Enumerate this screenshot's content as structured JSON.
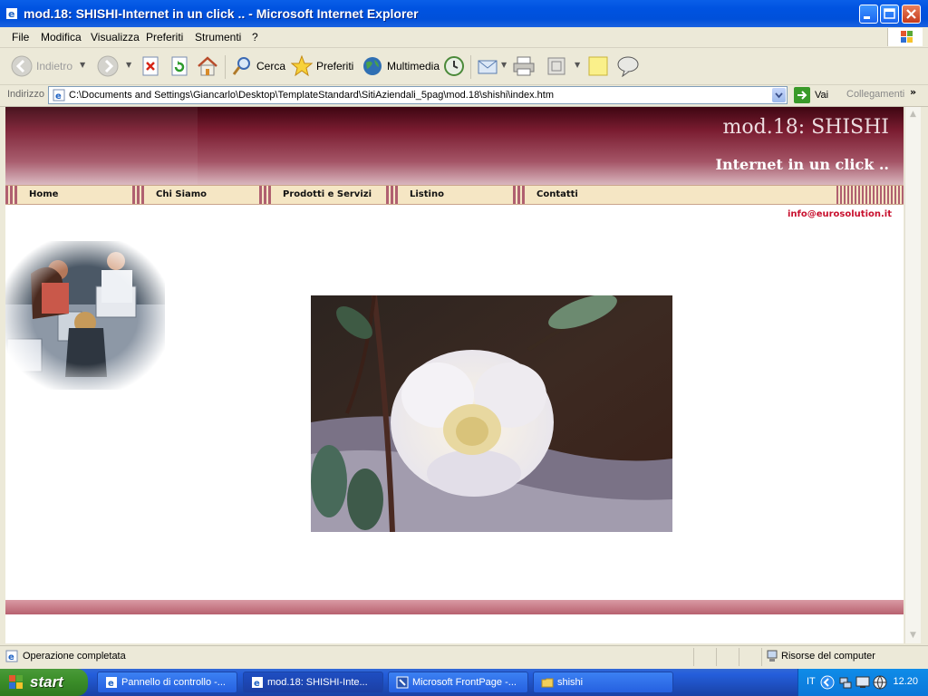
{
  "window": {
    "title": "mod.18: SHISHI-Internet in un click .. - Microsoft Internet Explorer"
  },
  "menu": [
    "File",
    "Modifica",
    "Visualizza",
    "Preferiti",
    "Strumenti",
    "?"
  ],
  "toolbar": {
    "back": "Indietro",
    "search": "Cerca",
    "favorites": "Preferiti",
    "media": "Multimedia"
  },
  "address": {
    "label": "Indirizzo",
    "url": "C:\\Documents and Settings\\Giancarlo\\Desktop\\TemplateStandard\\SitiAziendali_5pag\\mod.18\\shishi\\index.htm",
    "go": "Vai",
    "links": "Collegamenti"
  },
  "page": {
    "title": "mod.18: SHISHI",
    "subtitle": "Internet in un click ..",
    "nav": [
      "Home",
      "Chi Siamo",
      "Prodotti e Servizi",
      "Listino",
      "Contatti"
    ],
    "email": "info@eurosolution.it"
  },
  "status": {
    "text": "Operazione completata",
    "zone": "Risorse del computer"
  },
  "taskbar": {
    "start": "start",
    "tasks": [
      "Pannello di controllo -...",
      "mod.18: SHISHI-Inte...",
      "Microsoft FrontPage -...",
      "shishi"
    ],
    "lang": "IT",
    "clock": "12.20"
  },
  "colors": {
    "titlebar": "#0053e1",
    "header": "#7a1c30",
    "nav_bg": "#f5e6c4",
    "email": "#c8102e",
    "start": "#3c8f2a"
  }
}
